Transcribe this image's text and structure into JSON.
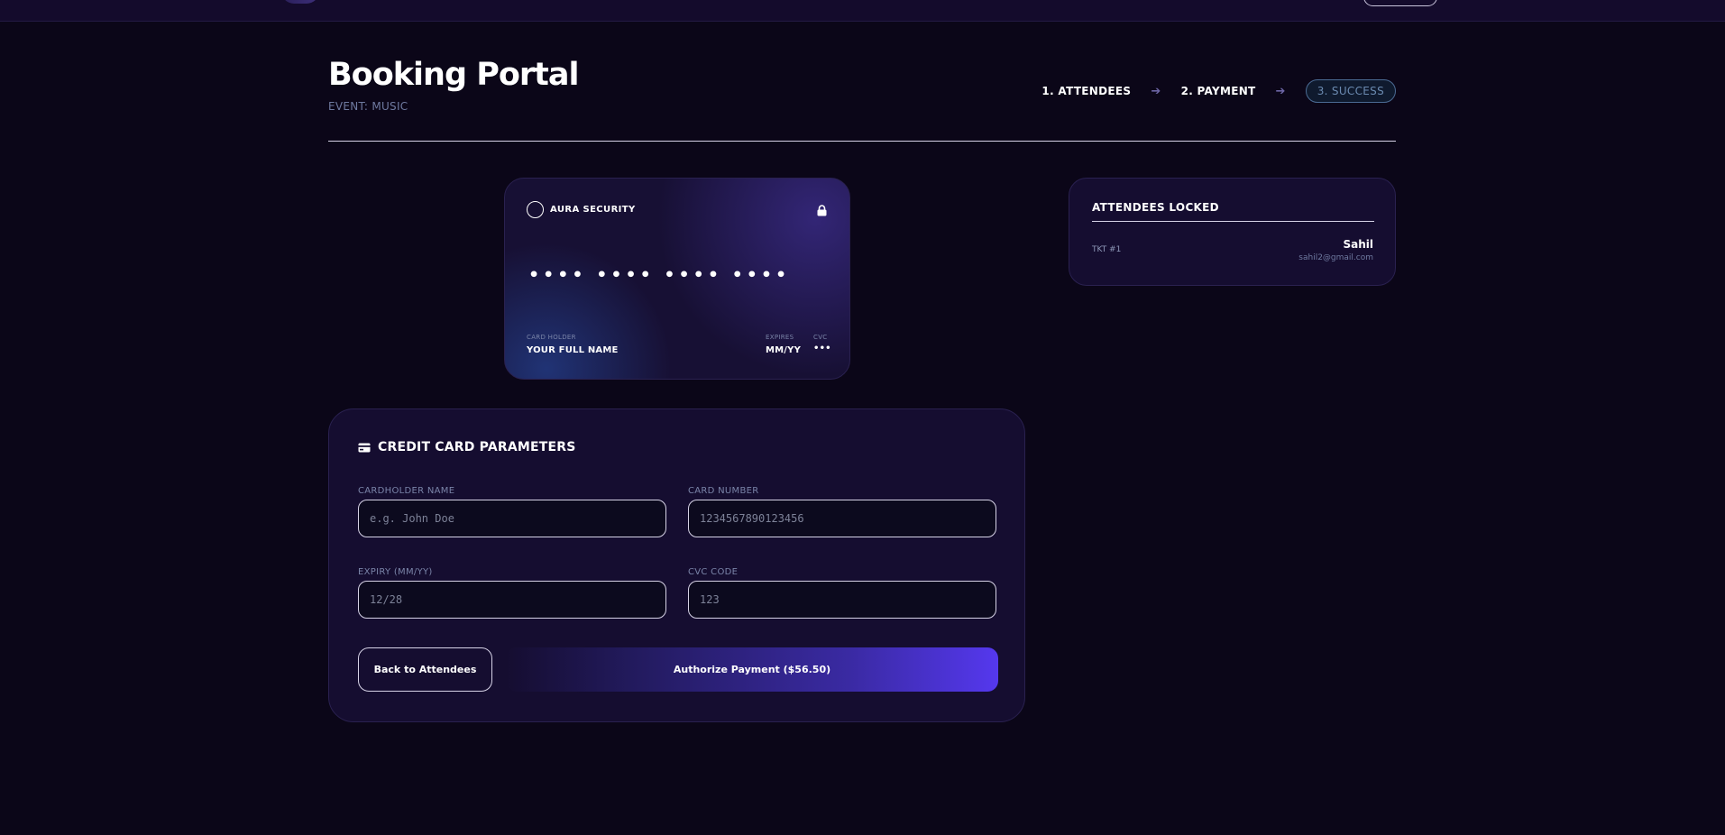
{
  "header": {
    "title": "Booking Portal",
    "subtitle": "EVENT: MUSIC"
  },
  "steps": [
    {
      "label": "1. ATTENDEES"
    },
    {
      "label": "2. PAYMENT"
    },
    {
      "label": "3. SUCCESS",
      "active": true
    }
  ],
  "card_preview": {
    "brand": "AURA SECURITY",
    "number": "•••• •••• •••• ••••",
    "holder_label": "CARD HOLDER",
    "holder_value": "YOUR FULL NAME",
    "expires_label": "EXPIRES",
    "expires_value": "MM/YY",
    "cvc_label": "CVC",
    "cvc_value": "•••"
  },
  "attendees": {
    "title": "ATTENDEES LOCKED",
    "items": [
      {
        "ticket": "TKT #1",
        "name": "Sahil",
        "email": "sahil2@gmail.com"
      }
    ]
  },
  "form": {
    "title": "CREDIT CARD PARAMETERS",
    "cardholder": {
      "label": "CARDHOLDER NAME",
      "placeholder": "e.g. John Doe",
      "value": ""
    },
    "card_number": {
      "label": "CARD NUMBER",
      "placeholder": "1234567890123456",
      "value": ""
    },
    "expiry": {
      "label": "EXPIRY (MM/YY)",
      "placeholder": "12/28",
      "value": ""
    },
    "cvc": {
      "label": "CVC CODE",
      "placeholder": "123",
      "value": ""
    },
    "back_label": "Back to Attendees",
    "pay_label": "Authorize Payment ($56.50)"
  },
  "colors": {
    "background": "#0b0618",
    "panel": "#150d30",
    "accent": "#5538ee",
    "muted_text": "#7a84a8"
  }
}
